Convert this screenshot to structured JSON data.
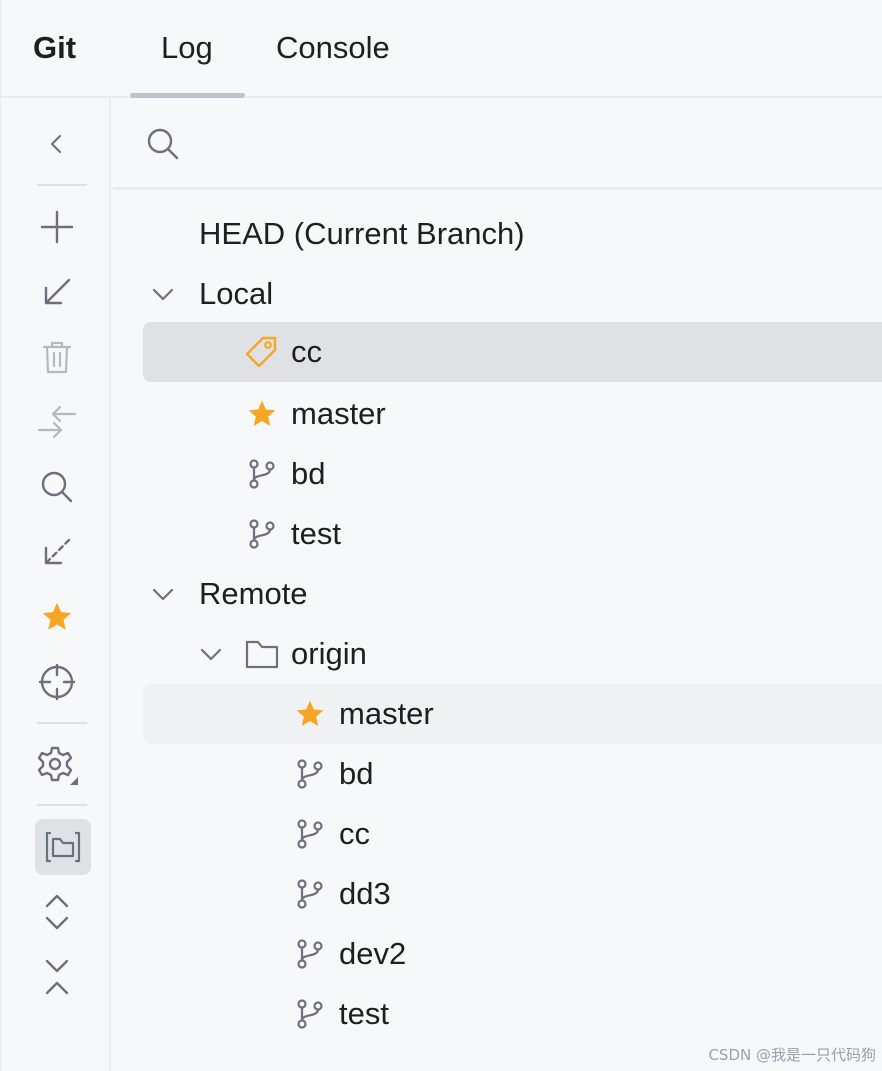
{
  "header": {
    "title": "Git",
    "tabs": [
      {
        "label": "Log",
        "active": true
      },
      {
        "label": "Console",
        "active": false
      }
    ]
  },
  "toolbar": {
    "buttons": [
      {
        "name": "collapse",
        "icon": "chevron-left-icon"
      },
      {
        "name": "new-branch",
        "icon": "plus-icon"
      },
      {
        "name": "update",
        "icon": "arrow-down-left-icon"
      },
      {
        "name": "delete",
        "icon": "trash-icon"
      },
      {
        "name": "compare",
        "icon": "compare-arrows-icon"
      },
      {
        "name": "search",
        "icon": "search-icon"
      },
      {
        "name": "fetch",
        "icon": "dashed-arrow-down-left-icon"
      },
      {
        "name": "favorite",
        "icon": "star-icon"
      },
      {
        "name": "locate",
        "icon": "crosshair-icon"
      },
      {
        "name": "settings",
        "icon": "gear-icon"
      },
      {
        "name": "group-by-directory",
        "icon": "folder-group-icon",
        "active": true
      },
      {
        "name": "expand-all",
        "icon": "expand-icon"
      },
      {
        "name": "collapse-all",
        "icon": "collapse-icon"
      }
    ]
  },
  "search": {
    "placeholder": "",
    "value": ""
  },
  "tree": {
    "head": {
      "label": "HEAD (Current Branch)"
    },
    "local": {
      "label": "Local",
      "items": [
        {
          "label": "cc",
          "icon": "tag-icon",
          "selected": true
        },
        {
          "label": "master",
          "icon": "star-icon"
        },
        {
          "label": "bd",
          "icon": "branch-icon"
        },
        {
          "label": "test",
          "icon": "branch-icon"
        }
      ]
    },
    "remote": {
      "label": "Remote",
      "origin": {
        "label": "origin",
        "items": [
          {
            "label": "master",
            "icon": "star-icon"
          },
          {
            "label": "bd",
            "icon": "branch-icon"
          },
          {
            "label": "cc",
            "icon": "branch-icon"
          },
          {
            "label": "dd3",
            "icon": "branch-icon"
          },
          {
            "label": "dev2",
            "icon": "branch-icon"
          },
          {
            "label": "test",
            "icon": "branch-icon"
          }
        ]
      }
    }
  },
  "colors": {
    "accent_star": "#f5a623",
    "tag_orange": "#f5a623",
    "icon_gray": "#6c707e",
    "selected_bg": "#dfe1e5"
  },
  "watermark": "CSDN @我是一只代码狗"
}
